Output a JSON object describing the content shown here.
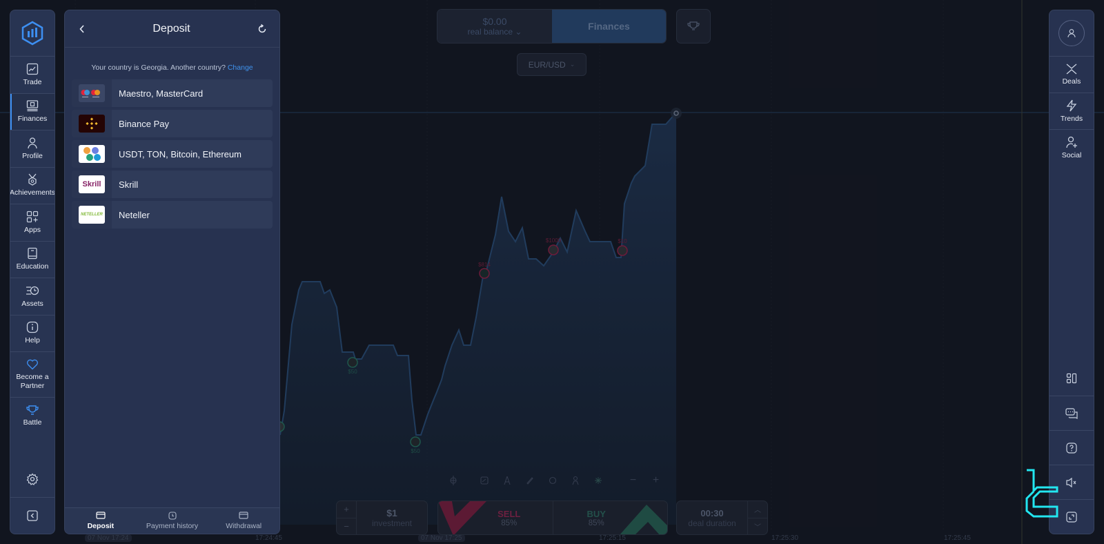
{
  "top_bar": {
    "balance_amount": "$0.00",
    "balance_label": "real balance",
    "finances_label": "Finances",
    "asset_pair": "EUR/USD"
  },
  "left_nav": {
    "items": [
      {
        "label": "Trade",
        "icon": "chart-line-icon"
      },
      {
        "label": "Finances",
        "icon": "finances-icon",
        "active": true
      },
      {
        "label": "Profile",
        "icon": "user-icon"
      },
      {
        "label": "Achievements",
        "icon": "medal-icon"
      },
      {
        "label": "Apps",
        "icon": "apps-grid-icon"
      },
      {
        "label": "Education",
        "icon": "book-icon"
      },
      {
        "label": "Assets",
        "icon": "assets-clock-icon"
      },
      {
        "label": "Help",
        "icon": "info-icon"
      },
      {
        "label": "Become a Partner",
        "icon": "heart-icon"
      },
      {
        "label": "Battle",
        "icon": "trophy-icon"
      }
    ],
    "bottom": [
      "gear-icon",
      "collapse-icon"
    ]
  },
  "deposit_panel": {
    "title": "Deposit",
    "country_text": "Your country is Georgia. Another country?",
    "change_link": "Change",
    "methods": [
      {
        "label": "Maestro, MasterCard",
        "logo": "maestro-mastercard-logo"
      },
      {
        "label": "Binance Pay",
        "logo": "binance-logo"
      },
      {
        "label": "USDT, TON, Bitcoin, Ethereum",
        "logo": "crypto-logo"
      },
      {
        "label": "Skrill",
        "logo": "skrill-logo",
        "logo_text": "Skrill"
      },
      {
        "label": "Neteller",
        "logo": "neteller-logo",
        "logo_text": "NETELLER"
      }
    ],
    "tabs": [
      {
        "label": "Deposit",
        "active": true
      },
      {
        "label": "Payment history"
      },
      {
        "label": "Withdrawal"
      }
    ]
  },
  "right_nav": {
    "items": [
      {
        "label": "Deals",
        "icon": "deals-icon"
      },
      {
        "label": "Trends",
        "icon": "lightning-icon"
      },
      {
        "label": "Social",
        "icon": "add-user-icon"
      }
    ],
    "bottom": [
      "layout-icon",
      "chat-icon",
      "help-icon",
      "mute-icon",
      "fullscreen-icon"
    ]
  },
  "trade_panel": {
    "investment_value": "$1",
    "investment_label": "investment",
    "sell_label": "SELL",
    "sell_percent": "85%",
    "buy_label": "BUY",
    "buy_percent": "85%",
    "duration_value": "00:30",
    "duration_label": "deal duration",
    "plus": "+",
    "minus": "−"
  },
  "chart": {
    "time_labels": [
      "07 Nov 17:24",
      "17:24:45",
      "07 Nov 17:25",
      "17:25:15",
      "17:25:30",
      "17:25:45"
    ],
    "trade_markers": [
      "$50",
      "$50",
      "$50",
      "$814",
      "$1000",
      "$10"
    ],
    "colors": {
      "line": "#2e5585",
      "sell": "#a3234f",
      "buy": "#2a7e6a",
      "accent": "#3d8ff1"
    }
  }
}
